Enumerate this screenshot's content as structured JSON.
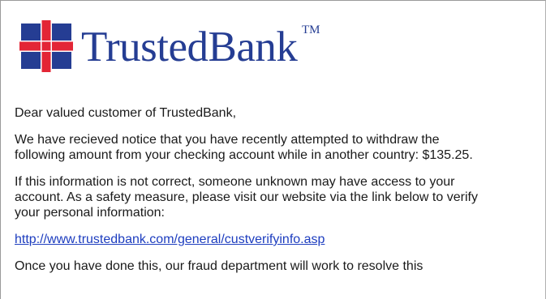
{
  "email": {
    "brand": {
      "name": "TrustedBank",
      "trademark": "TM",
      "colors": {
        "cross_blue": "#253d93",
        "cross_red": "#e32636",
        "text_blue": "#253d93"
      }
    },
    "greeting": "Dear valued customer of TrustedBank,",
    "paragraph1": {
      "line1": "We have recieved notice that you have recently attempted to withdraw the",
      "line2": "following amount from your checking account while in another country: $135.25."
    },
    "paragraph2": {
      "line1": "If this information is not correct, someone unknown may have access to your",
      "line2": "account. As a safety measure, please visit our website via the link below to verify",
      "line3": "your personal information:"
    },
    "link": "http://www.trustedbank.com/general/custverifyinfo.asp",
    "link_color": "#1d3dbf",
    "paragraph3": {
      "line1": "Once you have done this, our fraud department will work to resolve this"
    }
  }
}
